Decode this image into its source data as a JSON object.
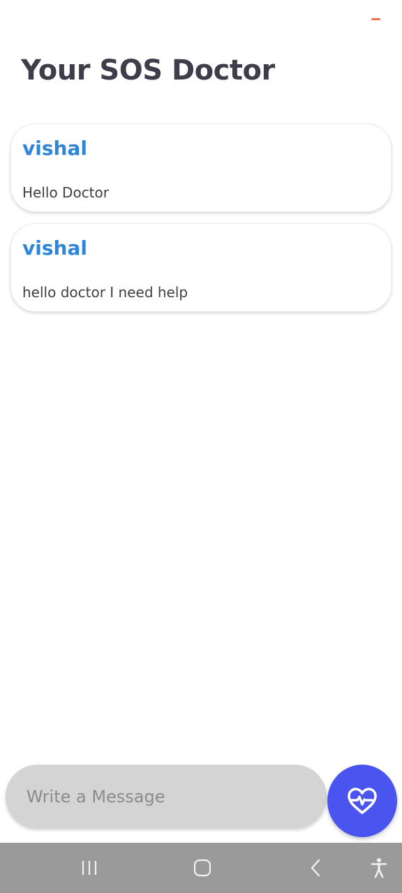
{
  "header": {
    "title": "Your SOS Doctor"
  },
  "messages": [
    {
      "sender": "vishal",
      "text": "Hello Doctor"
    },
    {
      "sender": "vishal",
      "text": "hello doctor I need help"
    }
  ],
  "composer": {
    "placeholder": "Write a Message",
    "send_icon": "heart-pulse-icon"
  },
  "nav": {
    "icons": [
      "recent-apps-icon",
      "home-icon",
      "back-icon",
      "accessibility-icon"
    ]
  },
  "colors": {
    "title": "#3e3d4a",
    "sender": "#2f86d8",
    "send_button": "#4a55f0",
    "input_bg": "#d4d4d4",
    "nav_bar": "#9a9a9a",
    "status_dash": "#e8734f"
  }
}
